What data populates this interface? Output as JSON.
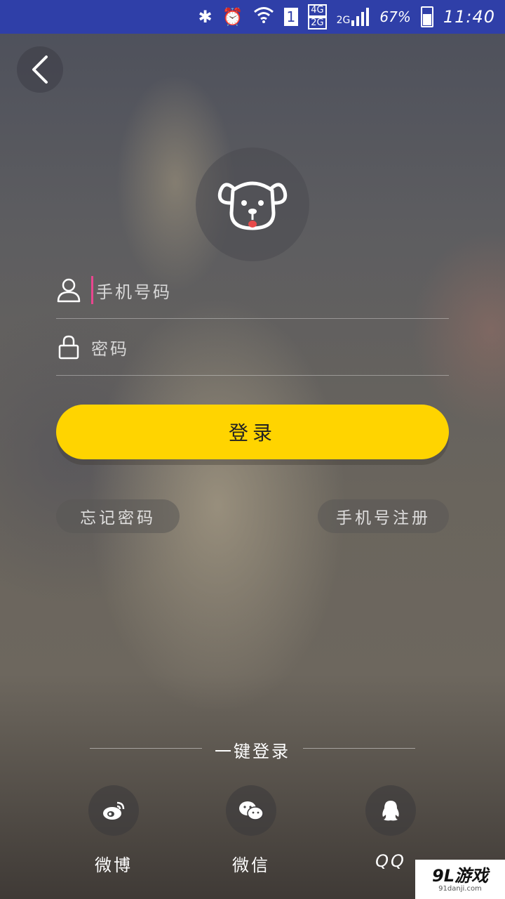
{
  "status_bar": {
    "network_1": "4G",
    "network_2": "2G",
    "network_3": "2G",
    "sim": "1",
    "battery": "67%",
    "time": "11:40"
  },
  "form": {
    "phone_placeholder": "手机号码",
    "password_placeholder": "密码",
    "login_label": "登录"
  },
  "links": {
    "forgot_password": "忘记密码",
    "phone_register": "手机号注册"
  },
  "quick_login": {
    "title": "一键登录",
    "items": [
      {
        "label": "微博",
        "icon": "weibo-icon"
      },
      {
        "label": "微信",
        "icon": "wechat-icon"
      },
      {
        "label": "QQ",
        "icon": "qq-icon"
      }
    ]
  },
  "watermark": {
    "main": "9L游戏",
    "sub": "91danji.com"
  },
  "colors": {
    "accent": "#ffd400",
    "caret": "#e9468f",
    "status_bar": "#2f3fa8"
  }
}
